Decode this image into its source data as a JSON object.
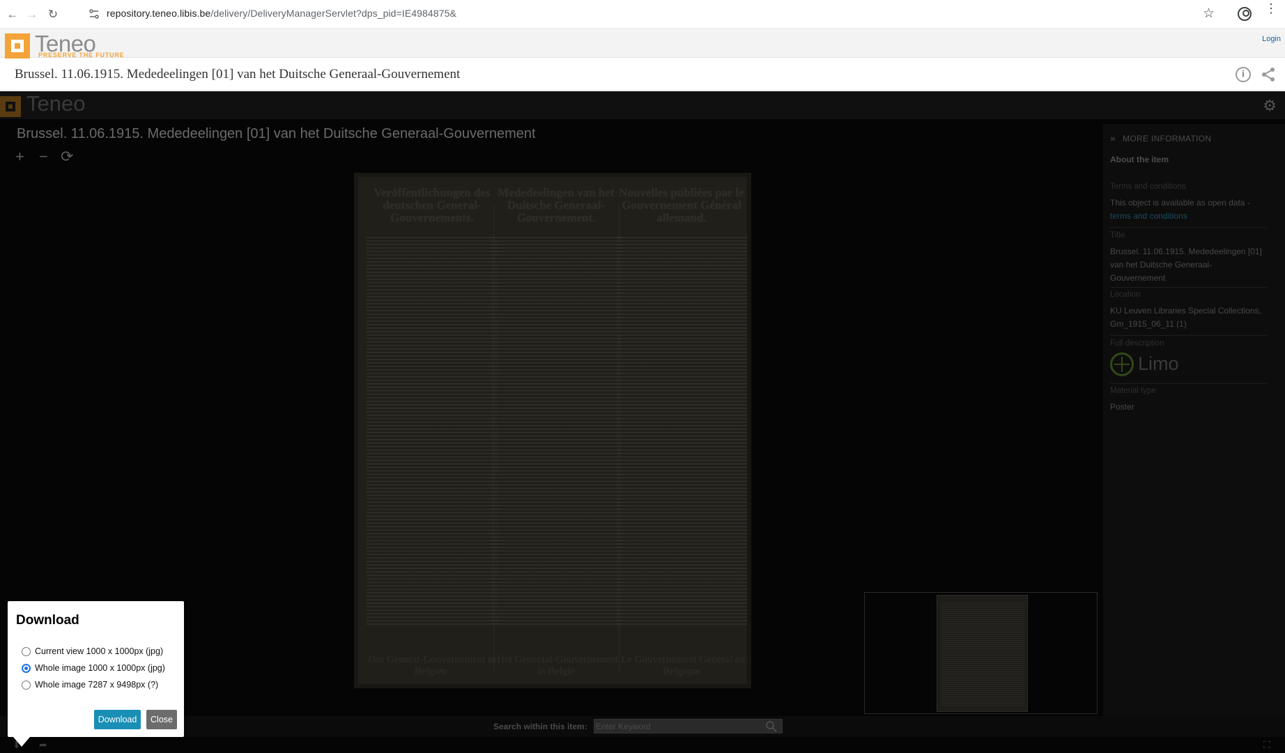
{
  "browser": {
    "url_host": "repository.teneo.libis.be",
    "url_path": "/delivery/DeliveryManagerServlet?dps_pid=IE4984875&"
  },
  "topbar": {
    "logo_text": "Teneo",
    "logo_tagline": "PRESERVE THE FUTURE",
    "login_label": "Login"
  },
  "page": {
    "title": "Brussel. 11.06.1915. Mededeelingen [01] van het Duitsche Generaal-Gouvernement"
  },
  "viewer": {
    "logo_text": "Teneo",
    "title": "Brussel. 11.06.1915. Mededeelingen [01] van het Duitsche Generaal-Gouvernement",
    "zoom_in": "+",
    "zoom_out": "−",
    "rotate": "⟳"
  },
  "document": {
    "columns": [
      {
        "heading": "Veröffentlichungen des deutschen General-Gouvernements.",
        "footer": "Das General-Gouvernement in Belgien."
      },
      {
        "heading": "Mededeelingen van het Duitsche Generaal-Gouvernement.",
        "footer": "Het Generaal-Gouvernement in België."
      },
      {
        "heading": "Nouvelles publiées par le Gouvernement Général allemand.",
        "footer": "Le Gouvernement Général en Belgique."
      }
    ]
  },
  "panel": {
    "header": "MORE INFORMATION",
    "about": "About the item",
    "terms_label": "Terms and conditions",
    "terms_value": "This object is available as open data - ",
    "terms_link": "terms and conditions",
    "title_label": "Title",
    "title_value": "Brussel. 11.06.1915. Mededeelingen [01] van het Duitsche Generaal-Gouvernement",
    "location_label": "Location",
    "location_value": "KU Leuven Libraries Special Collections, Gm_1915_06_11 (1)",
    "description_label": "Full description",
    "limo_text": "Limo",
    "material_label": "Material type",
    "material_value": "Poster"
  },
  "search": {
    "label": "Search within this item:",
    "placeholder": "Enter Keyword"
  },
  "download_dialog": {
    "title": "Download",
    "options": [
      {
        "label": "Current view 1000 x 1000px (jpg)",
        "selected": false
      },
      {
        "label": "Whole image 1000 x 1000px (jpg)",
        "selected": true
      },
      {
        "label": "Whole image 7287 x 9498px (?)",
        "selected": false
      }
    ],
    "download_label": "Download",
    "close_label": "Close"
  },
  "colors": {
    "download_button": "#1a8fb5",
    "close_button": "#6c6c6c",
    "logo_orange": "#f3a339"
  }
}
